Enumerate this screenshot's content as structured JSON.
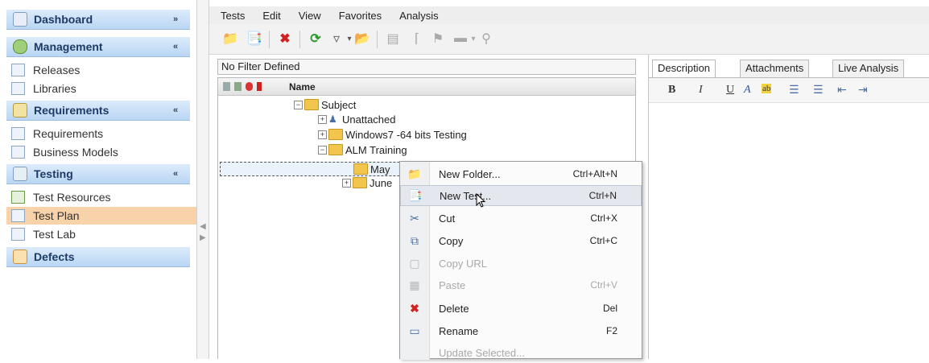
{
  "sidebar": {
    "sections": [
      {
        "label": "Dashboard",
        "chevron": "»"
      },
      {
        "label": "Management",
        "chevron": "«"
      },
      {
        "label": "Requirements",
        "chevron": "«"
      },
      {
        "label": "Testing",
        "chevron": "«"
      },
      {
        "label": "Defects",
        "chevron": ""
      }
    ],
    "items": [
      {
        "label": "Releases"
      },
      {
        "label": "Libraries"
      },
      {
        "label": "Requirements"
      },
      {
        "label": "Business Models"
      },
      {
        "label": "Test Resources"
      },
      {
        "label": "Test Plan"
      },
      {
        "label": "Test Lab"
      }
    ]
  },
  "menubar": [
    "Tests",
    "Edit",
    "View",
    "Favorites",
    "Analysis"
  ],
  "filter": {
    "text": "No Filter Defined"
  },
  "tree": {
    "header_name": "Name",
    "nodes": [
      {
        "label": "Subject",
        "expander": "−"
      },
      {
        "label": "Unattached",
        "expander": "+"
      },
      {
        "label": "Windows7 -64 bits Testing",
        "expander": "+"
      },
      {
        "label": "ALM Training",
        "expander": "−"
      },
      {
        "label": "May",
        "expander": ""
      },
      {
        "label": "June",
        "expander": "+"
      }
    ]
  },
  "details": {
    "tabs": [
      "Description",
      "Attachments",
      "Live Analysis"
    ],
    "format_buttons": [
      "B",
      "I",
      "U",
      "A",
      "ab"
    ]
  },
  "context_menu": [
    {
      "label": "New Folder...",
      "shortcut": "Ctrl+Alt+N",
      "icon": "new-folder-icon",
      "state": "normal"
    },
    {
      "label": "New Test...",
      "shortcut": "Ctrl+N",
      "icon": "new-test-icon",
      "state": "hover"
    },
    {
      "label": "Cut",
      "shortcut": "Ctrl+X",
      "icon": "cut-icon",
      "state": "normal"
    },
    {
      "label": "Copy",
      "shortcut": "Ctrl+C",
      "icon": "copy-icon",
      "state": "normal"
    },
    {
      "label": "Copy URL",
      "shortcut": "",
      "icon": "copy-url-icon",
      "state": "disabled"
    },
    {
      "label": "Paste",
      "shortcut": "Ctrl+V",
      "icon": "paste-icon",
      "state": "disabled"
    },
    {
      "label": "Delete",
      "shortcut": "Del",
      "icon": "delete-icon",
      "state": "normal"
    },
    {
      "label": "Rename",
      "shortcut": "F2",
      "icon": "rename-icon",
      "state": "normal"
    },
    {
      "label": "Update Selected...",
      "shortcut": "",
      "icon": "",
      "state": "disabled"
    }
  ],
  "colors": {
    "sidebar_header": "#b9d6f3",
    "active_item": "#f8d2a8",
    "folder": "#f2c64c",
    "delete_red": "#d32020",
    "refresh_green": "#2e9a2e"
  }
}
